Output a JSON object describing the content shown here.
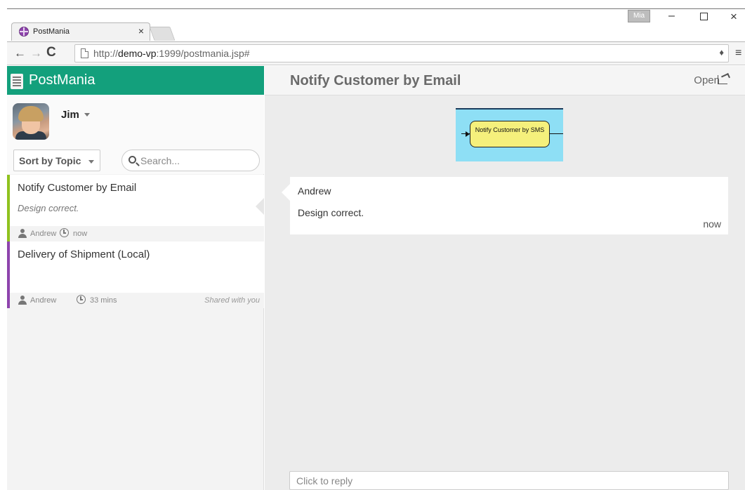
{
  "browser": {
    "tab_title": "PostMania",
    "tab_close": "×",
    "user_badge": "Mia",
    "win_min": "–",
    "win_close": "×",
    "url_prefix": "http://",
    "url_host": "demo-vp",
    "url_rest": ":1999/postmania.jsp#"
  },
  "app": {
    "brand": "PostMania",
    "user": {
      "name": "Jim"
    },
    "sort": {
      "label": "Sort by Topic"
    },
    "search": {
      "placeholder": "Search..."
    },
    "posts": [
      {
        "title": "Notify Customer by Email",
        "snippet": "Design correct.",
        "author": "Andrew",
        "time": "now",
        "shared": "",
        "accent": "#8fc21e",
        "selected": true
      },
      {
        "title": "Delivery of Shipment (Local)",
        "snippet": "",
        "author": "Andrew",
        "time": "33 mins",
        "shared": "Shared with you",
        "accent": "#8e44ad",
        "selected": false
      }
    ],
    "detail": {
      "title": "Notify Customer by Email",
      "open_label": "Open",
      "diagram_node": "Notify Customer by SMS",
      "comment": {
        "author": "Andrew",
        "body": "Design correct.",
        "time": "now"
      },
      "reply_placeholder": "Click to reply"
    }
  },
  "colors": {
    "brand": "#13a07c",
    "diagram_bg": "#8edff5",
    "diagram_node": "#f5f07c"
  }
}
